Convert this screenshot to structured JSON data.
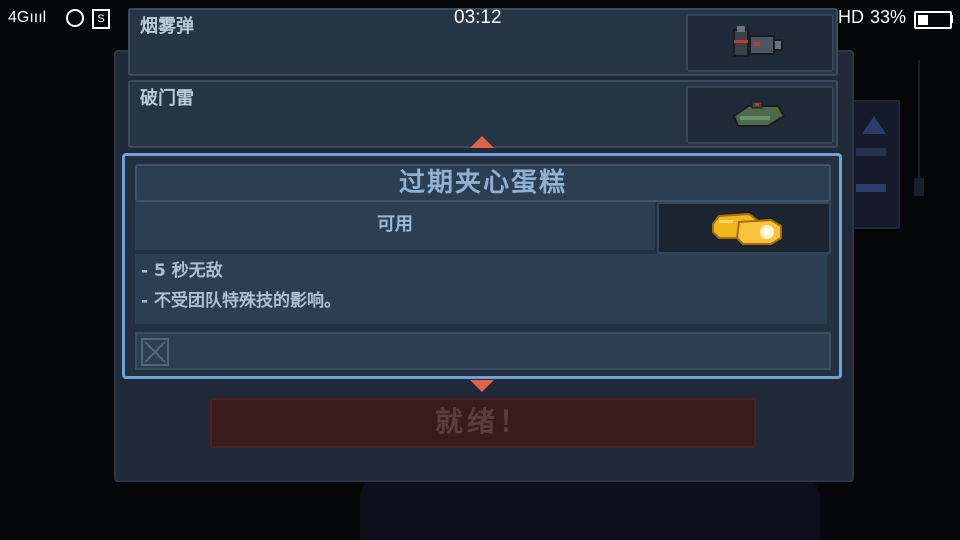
{
  "status_bar": {
    "network": "4G",
    "time": "03:12",
    "hd": "HD",
    "battery_text": "33%",
    "battery_level": 0.33
  },
  "list": {
    "items": [
      {
        "label": "烟雾弹",
        "icon": "smoke-grenade-icon"
      },
      {
        "label": "破门雷",
        "icon": "breaching-charge-icon"
      }
    ]
  },
  "detail": {
    "title": "过期夹心蛋糕",
    "status": "可用",
    "icon": "cake-icon",
    "desc_lines": [
      "- 5 秒无敌",
      "- 不受团队特殊技的影响。"
    ]
  },
  "ready_label": "就绪！",
  "colors": {
    "dialog_border": "#6fa0d6",
    "arrow": "#e0624a",
    "ready_bg": "#3a1a1a"
  }
}
